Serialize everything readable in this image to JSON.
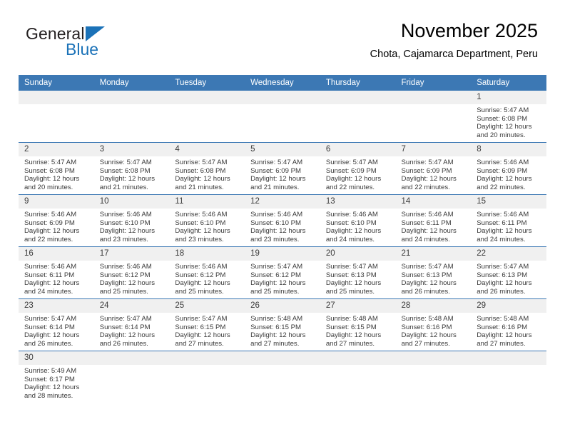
{
  "brand": {
    "name_part1": "General",
    "name_part2": "Blue",
    "logo_icon": "triangle-logo-icon",
    "accent_color": "#1b72b8"
  },
  "header": {
    "title": "November 2025",
    "subtitle": "Chota, Cajamarca Department, Peru"
  },
  "calendar": {
    "header_color": "#3c78b4",
    "daynum_bg": "#f0f0f0",
    "weekdays": [
      "Sunday",
      "Monday",
      "Tuesday",
      "Wednesday",
      "Thursday",
      "Friday",
      "Saturday"
    ],
    "weeks": [
      [
        {
          "day": "",
          "lines": []
        },
        {
          "day": "",
          "lines": []
        },
        {
          "day": "",
          "lines": []
        },
        {
          "day": "",
          "lines": []
        },
        {
          "day": "",
          "lines": []
        },
        {
          "day": "",
          "lines": []
        },
        {
          "day": "1",
          "lines": [
            "Sunrise: 5:47 AM",
            "Sunset: 6:08 PM",
            "Daylight: 12 hours",
            "and 20 minutes."
          ]
        }
      ],
      [
        {
          "day": "2",
          "lines": [
            "Sunrise: 5:47 AM",
            "Sunset: 6:08 PM",
            "Daylight: 12 hours",
            "and 20 minutes."
          ]
        },
        {
          "day": "3",
          "lines": [
            "Sunrise: 5:47 AM",
            "Sunset: 6:08 PM",
            "Daylight: 12 hours",
            "and 21 minutes."
          ]
        },
        {
          "day": "4",
          "lines": [
            "Sunrise: 5:47 AM",
            "Sunset: 6:08 PM",
            "Daylight: 12 hours",
            "and 21 minutes."
          ]
        },
        {
          "day": "5",
          "lines": [
            "Sunrise: 5:47 AM",
            "Sunset: 6:09 PM",
            "Daylight: 12 hours",
            "and 21 minutes."
          ]
        },
        {
          "day": "6",
          "lines": [
            "Sunrise: 5:47 AM",
            "Sunset: 6:09 PM",
            "Daylight: 12 hours",
            "and 22 minutes."
          ]
        },
        {
          "day": "7",
          "lines": [
            "Sunrise: 5:47 AM",
            "Sunset: 6:09 PM",
            "Daylight: 12 hours",
            "and 22 minutes."
          ]
        },
        {
          "day": "8",
          "lines": [
            "Sunrise: 5:46 AM",
            "Sunset: 6:09 PM",
            "Daylight: 12 hours",
            "and 22 minutes."
          ]
        }
      ],
      [
        {
          "day": "9",
          "lines": [
            "Sunrise: 5:46 AM",
            "Sunset: 6:09 PM",
            "Daylight: 12 hours",
            "and 22 minutes."
          ]
        },
        {
          "day": "10",
          "lines": [
            "Sunrise: 5:46 AM",
            "Sunset: 6:10 PM",
            "Daylight: 12 hours",
            "and 23 minutes."
          ]
        },
        {
          "day": "11",
          "lines": [
            "Sunrise: 5:46 AM",
            "Sunset: 6:10 PM",
            "Daylight: 12 hours",
            "and 23 minutes."
          ]
        },
        {
          "day": "12",
          "lines": [
            "Sunrise: 5:46 AM",
            "Sunset: 6:10 PM",
            "Daylight: 12 hours",
            "and 23 minutes."
          ]
        },
        {
          "day": "13",
          "lines": [
            "Sunrise: 5:46 AM",
            "Sunset: 6:10 PM",
            "Daylight: 12 hours",
            "and 24 minutes."
          ]
        },
        {
          "day": "14",
          "lines": [
            "Sunrise: 5:46 AM",
            "Sunset: 6:11 PM",
            "Daylight: 12 hours",
            "and 24 minutes."
          ]
        },
        {
          "day": "15",
          "lines": [
            "Sunrise: 5:46 AM",
            "Sunset: 6:11 PM",
            "Daylight: 12 hours",
            "and 24 minutes."
          ]
        }
      ],
      [
        {
          "day": "16",
          "lines": [
            "Sunrise: 5:46 AM",
            "Sunset: 6:11 PM",
            "Daylight: 12 hours",
            "and 24 minutes."
          ]
        },
        {
          "day": "17",
          "lines": [
            "Sunrise: 5:46 AM",
            "Sunset: 6:12 PM",
            "Daylight: 12 hours",
            "and 25 minutes."
          ]
        },
        {
          "day": "18",
          "lines": [
            "Sunrise: 5:46 AM",
            "Sunset: 6:12 PM",
            "Daylight: 12 hours",
            "and 25 minutes."
          ]
        },
        {
          "day": "19",
          "lines": [
            "Sunrise: 5:47 AM",
            "Sunset: 6:12 PM",
            "Daylight: 12 hours",
            "and 25 minutes."
          ]
        },
        {
          "day": "20",
          "lines": [
            "Sunrise: 5:47 AM",
            "Sunset: 6:13 PM",
            "Daylight: 12 hours",
            "and 25 minutes."
          ]
        },
        {
          "day": "21",
          "lines": [
            "Sunrise: 5:47 AM",
            "Sunset: 6:13 PM",
            "Daylight: 12 hours",
            "and 26 minutes."
          ]
        },
        {
          "day": "22",
          "lines": [
            "Sunrise: 5:47 AM",
            "Sunset: 6:13 PM",
            "Daylight: 12 hours",
            "and 26 minutes."
          ]
        }
      ],
      [
        {
          "day": "23",
          "lines": [
            "Sunrise: 5:47 AM",
            "Sunset: 6:14 PM",
            "Daylight: 12 hours",
            "and 26 minutes."
          ]
        },
        {
          "day": "24",
          "lines": [
            "Sunrise: 5:47 AM",
            "Sunset: 6:14 PM",
            "Daylight: 12 hours",
            "and 26 minutes."
          ]
        },
        {
          "day": "25",
          "lines": [
            "Sunrise: 5:47 AM",
            "Sunset: 6:15 PM",
            "Daylight: 12 hours",
            "and 27 minutes."
          ]
        },
        {
          "day": "26",
          "lines": [
            "Sunrise: 5:48 AM",
            "Sunset: 6:15 PM",
            "Daylight: 12 hours",
            "and 27 minutes."
          ]
        },
        {
          "day": "27",
          "lines": [
            "Sunrise: 5:48 AM",
            "Sunset: 6:15 PM",
            "Daylight: 12 hours",
            "and 27 minutes."
          ]
        },
        {
          "day": "28",
          "lines": [
            "Sunrise: 5:48 AM",
            "Sunset: 6:16 PM",
            "Daylight: 12 hours",
            "and 27 minutes."
          ]
        },
        {
          "day": "29",
          "lines": [
            "Sunrise: 5:48 AM",
            "Sunset: 6:16 PM",
            "Daylight: 12 hours",
            "and 27 minutes."
          ]
        }
      ],
      [
        {
          "day": "30",
          "lines": [
            "Sunrise: 5:49 AM",
            "Sunset: 6:17 PM",
            "Daylight: 12 hours",
            "and 28 minutes."
          ]
        },
        {
          "day": "",
          "lines": []
        },
        {
          "day": "",
          "lines": []
        },
        {
          "day": "",
          "lines": []
        },
        {
          "day": "",
          "lines": []
        },
        {
          "day": "",
          "lines": []
        },
        {
          "day": "",
          "lines": []
        }
      ]
    ]
  }
}
